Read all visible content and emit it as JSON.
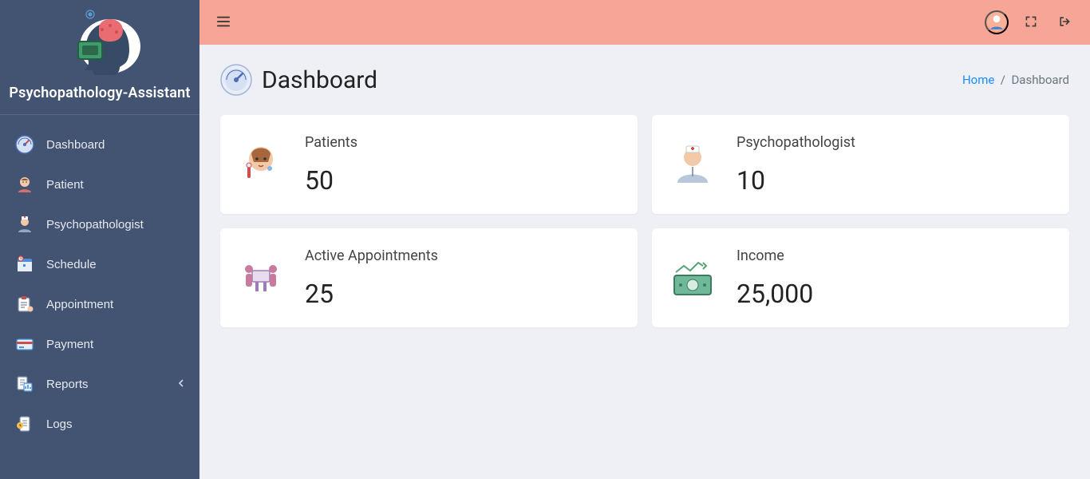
{
  "app": {
    "title": "Psychopathology-Assistant"
  },
  "sidebar": {
    "items": [
      {
        "label": "Dashboard",
        "icon": "gauge-icon",
        "has_children": false
      },
      {
        "label": "Patient",
        "icon": "patient-icon",
        "has_children": false
      },
      {
        "label": "Psychopathologist",
        "icon": "doctor-icon",
        "has_children": false
      },
      {
        "label": "Schedule",
        "icon": "calendar-icon",
        "has_children": false
      },
      {
        "label": "Appointment",
        "icon": "clipboard-icon",
        "has_children": false
      },
      {
        "label": "Payment",
        "icon": "credit-card-icon",
        "has_children": false
      },
      {
        "label": "Reports",
        "icon": "reports-icon",
        "has_children": true
      },
      {
        "label": "Logs",
        "icon": "logs-icon",
        "has_children": false
      }
    ]
  },
  "header": {
    "page_title": "Dashboard",
    "breadcrumb": {
      "home_label": "Home",
      "separator": "/",
      "current": "Dashboard"
    }
  },
  "cards": [
    {
      "title": "Patients",
      "value": "50",
      "icon": "patient-card-icon"
    },
    {
      "title": "Psychopathologist",
      "value": "10",
      "icon": "doctor-card-icon"
    },
    {
      "title": "Active Appointments",
      "value": "25",
      "icon": "appointment-card-icon"
    },
    {
      "title": "Income",
      "value": "25,000",
      "icon": "income-card-icon"
    }
  ],
  "colors": {
    "sidebar_bg": "#435473",
    "topbar_bg": "#f6a596",
    "page_bg": "#eef0f5",
    "link": "#1a8cff"
  }
}
